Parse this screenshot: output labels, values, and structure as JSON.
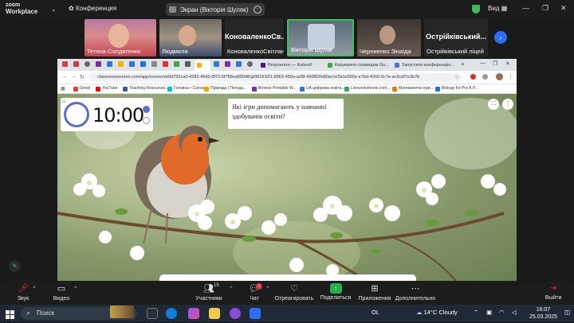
{
  "zoom": {
    "logo_line1": "zoom",
    "logo_line2": "Workplace",
    "meeting_label": "Конференция",
    "screen_share_label": "Экран (Вікторія Шуляк)",
    "view_label": "Вид"
  },
  "participants": [
    {
      "name": "Тетяна Солдатенко"
    },
    {
      "name": "Людмила"
    },
    {
      "name": "КоноваленкоСвітлана",
      "big": "КоноваленкоСв..."
    },
    {
      "name": "Вікторія Шуляк"
    },
    {
      "name": "Черниенко Зінаїда"
    },
    {
      "name": "Острійківський ліцей",
      "big": "Острійківський..."
    }
  ],
  "browser": {
    "tabs": [
      {
        "label": "Результати — Kahoot!"
      },
      {
        "label": "Керування сховищем Go..."
      },
      {
        "label": "Запустити конференцію..."
      }
    ],
    "url": "classroomscreen.com/app/screen/w/6d792ca0-4282-45d5-8f73-5f789ea89048/g/081fc921-8963-458a-a28f-490f82fe80ec/s/3a1e565e-e7bd-4260-9c7e-ac9cdf7e2b7b",
    "bookmarks": [
      {
        "label": "Gmail"
      },
      {
        "label": "YouTube"
      },
      {
        "label": "Teaching Resources..."
      },
      {
        "label": "Головна • Canva"
      },
      {
        "label": "Природа | Погода..."
      },
      {
        "label": "Browse Printable W..."
      },
      {
        "label": "UA цифрова освіта..."
      },
      {
        "label": "Liveworksheets.com..."
      },
      {
        "label": "Математичні ігри..."
      },
      {
        "label": "Biology for Pre-K P..."
      }
    ]
  },
  "classroom": {
    "timer": "10:00",
    "question": "Які ігри допомагають у навчанні здобувачів освіти?"
  },
  "toolbar": {
    "audio": "Звук",
    "video": "Видео",
    "participants": "Участники",
    "participants_count": "15",
    "chat": "Чат",
    "chat_badge": "1",
    "react": "Отреагировать",
    "share": "Поделиться",
    "apps": "Приложения",
    "more": "Дополнительно",
    "leave": "Выйти"
  },
  "taskbar": {
    "search_placeholder": "Поиск",
    "lang": "OL",
    "weather": "14°C  Cloudy",
    "time": "16:07",
    "date": "25.03.2025"
  },
  "colors": {
    "zoom_bg": "#1c1c1c",
    "share_green": "#25b24b",
    "leave_red": "#e0293a",
    "active_speaker": "#39c35b"
  }
}
